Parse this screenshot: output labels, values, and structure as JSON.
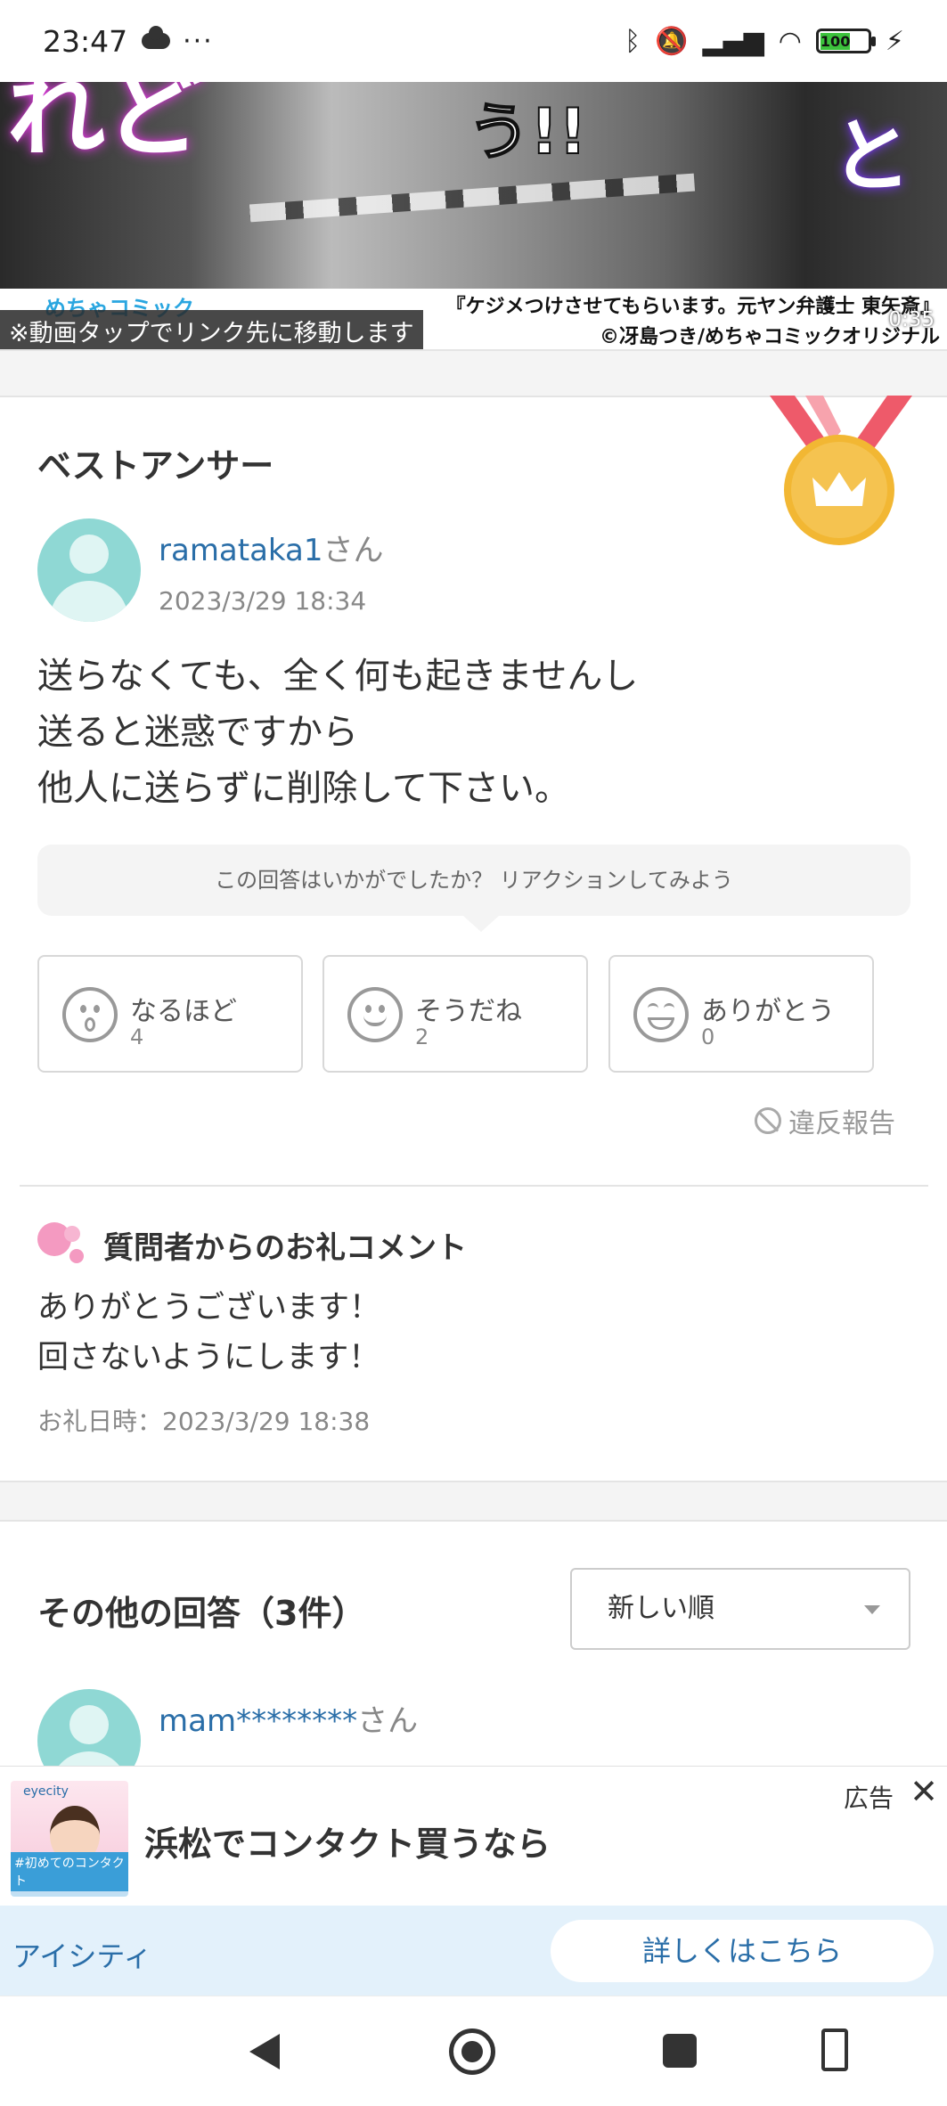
{
  "status_bar": {
    "time": "23:47",
    "dots": "···",
    "battery": "100",
    "icons": [
      "cloud-icon",
      "bluetooth-icon",
      "mute-icon",
      "signal-icon",
      "wifi-icon",
      "battery-icon",
      "charging-icon"
    ]
  },
  "video_banner": {
    "kana_left": "れど",
    "kana_center": "う!!",
    "kana_right": "と",
    "logo_fragment": "めちゃコミック",
    "credit_line1": "『ケジメつけさせてもらいます。元ヤン弁護士 東矢斎』",
    "credit_line2": "©冴島つき/めちゃコミックオリジナル",
    "tap_note": "※動画タップでリンク先に移動します",
    "duration": "0:35"
  },
  "best_answer": {
    "section_title": "ベストアンサー",
    "username": "ramataka1",
    "honorific": "さん",
    "date": "2023/3/29 18:34",
    "lines": [
      "送らなくても、全く何も起きませんし",
      "送ると迷惑ですから",
      "他人に送らずに削除して下さい。"
    ],
    "reaction_prompt": "この回答はいかがでしたか？ リアクションしてみよう",
    "reactions": [
      {
        "label": "なるほど",
        "count": "4"
      },
      {
        "label": "そうだね",
        "count": "2"
      },
      {
        "label": "ありがとう",
        "count": "0"
      }
    ],
    "report_label": "違反報告"
  },
  "thanks": {
    "title": "質問者からのお礼コメント",
    "lines": [
      "ありがとうございます！",
      "回さないようにします！"
    ],
    "date_label": "お礼日時：2023/3/29 18:38"
  },
  "other_answers": {
    "title": "その他の回答（3件）",
    "sort_value": "新しい順",
    "first_username": "mam********",
    "first_honorific": "さん"
  },
  "ad": {
    "label": "広告",
    "brand_small": "eyecity",
    "thumb_tag": "#初めてのコンタクト",
    "headline": "浜松でコンタクト買うなら",
    "advertiser": "アイシティ",
    "cta": "詳しくはこちら"
  },
  "colors": {
    "link": "#2a6ea8",
    "avatar": "#8fd8d4",
    "medal": "#f2b733",
    "ribbon": "#ee5a6a",
    "ad_bg": "#e3f1fb"
  }
}
